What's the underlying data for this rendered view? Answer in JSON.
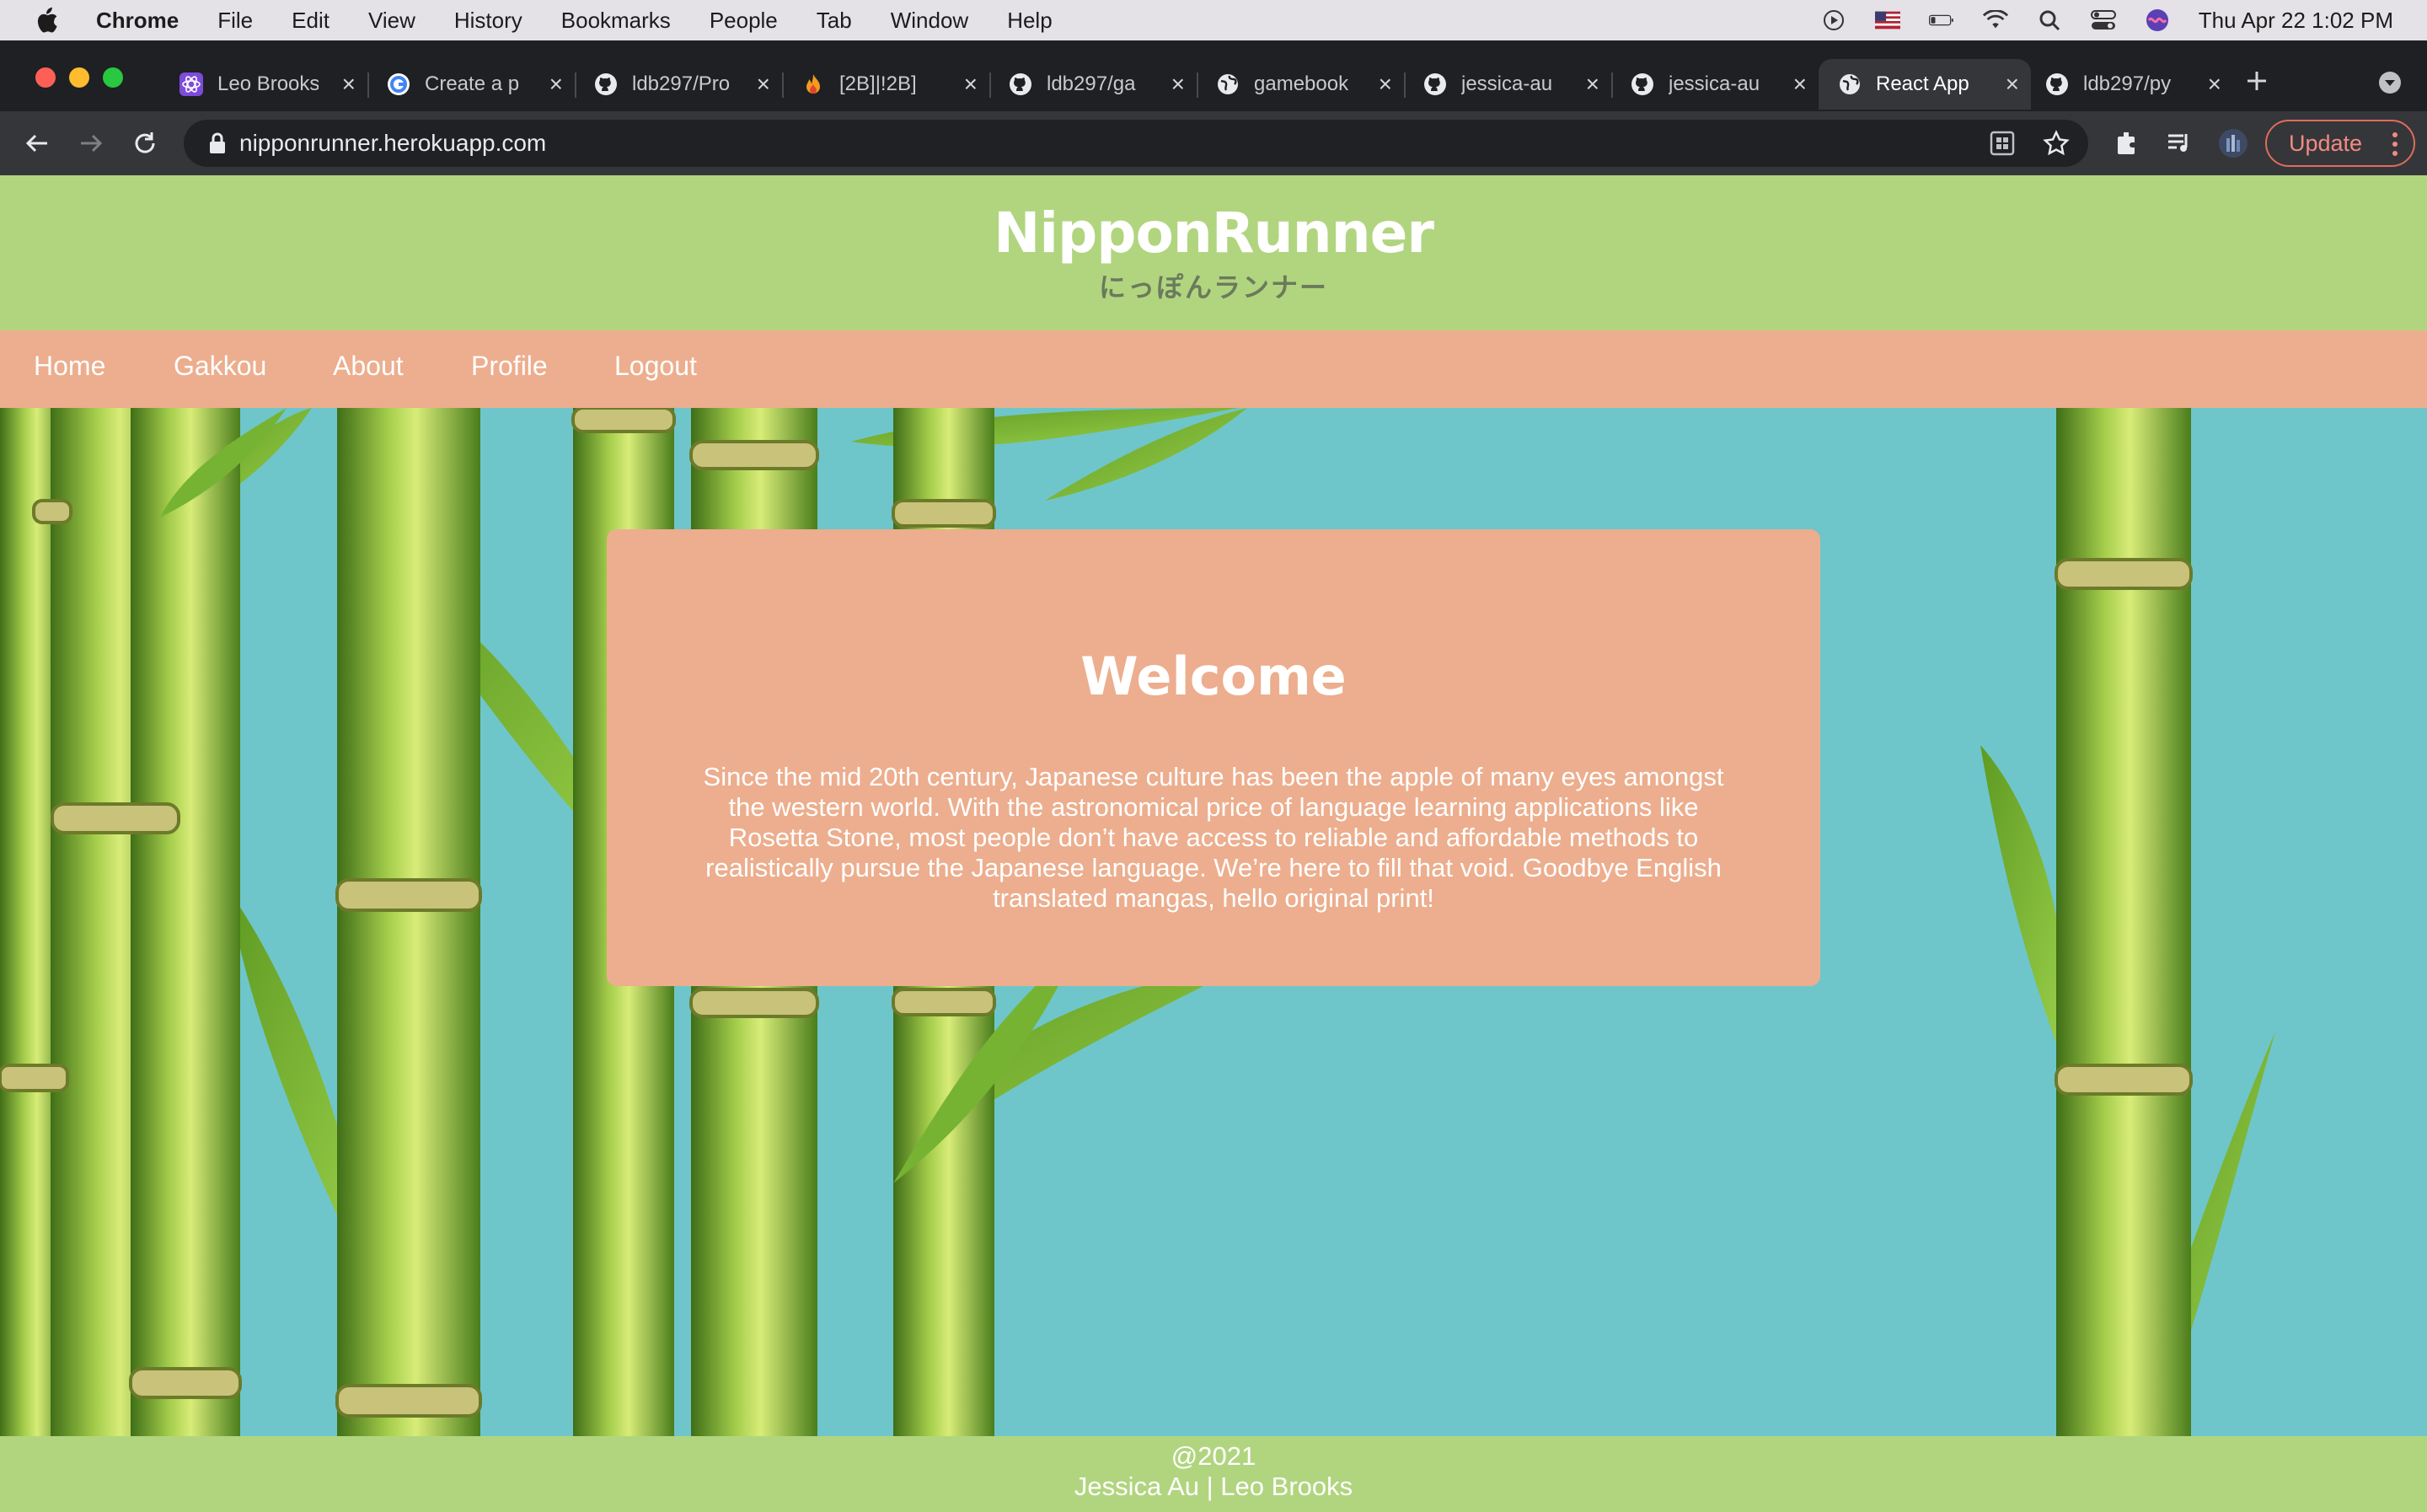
{
  "menubar": {
    "app": "Chrome",
    "items": [
      "File",
      "Edit",
      "View",
      "History",
      "Bookmarks",
      "People",
      "Tab",
      "Window",
      "Help"
    ],
    "clock": "Thu Apr 22  1:02 PM"
  },
  "tabs": [
    {
      "label": "Leo Brooks",
      "icon": "react-icon"
    },
    {
      "label": "Create a p",
      "icon": "google-icon"
    },
    {
      "label": "ldb297/Pro",
      "icon": "github-icon"
    },
    {
      "label": "[2B]|!2B]",
      "icon": "flame-icon"
    },
    {
      "label": "ldb297/ga",
      "icon": "github-icon"
    },
    {
      "label": "gamebook",
      "icon": "globe-icon"
    },
    {
      "label": "jessica-au",
      "icon": "github-icon"
    },
    {
      "label": "jessica-au",
      "icon": "github-icon"
    },
    {
      "label": "React App",
      "icon": "globe-icon",
      "active": true
    },
    {
      "label": "ldb297/py",
      "icon": "github-icon"
    }
  ],
  "toolbar": {
    "url": "nipponrunner.herokuapp.com",
    "update_label": "Update"
  },
  "site": {
    "title": "NipponRunner",
    "subtitle": "にっぽんランナー",
    "nav": [
      "Home",
      "Gakkou",
      "About",
      "Profile",
      "Logout"
    ],
    "welcome_title": "Welcome",
    "welcome_body": "Since the mid 20th century, Japanese culture has been the apple of many eyes amongst the western world. With the astronomical price of language learning applications like Rosetta Stone, most people don’t have access to reliable and affordable methods to realistically pursue the Japanese language. We’re here to fill that void. Goodbye English translated mangas, hello original print!",
    "footer_line1": "@2021",
    "footer_line2": "Jessica Au | Leo Brooks"
  },
  "colors": {
    "header_green": "#b1d57f",
    "nav_peach": "#ecae8e",
    "background_teal": "#6ec6cb",
    "bamboo_green": "#7fb13a"
  }
}
